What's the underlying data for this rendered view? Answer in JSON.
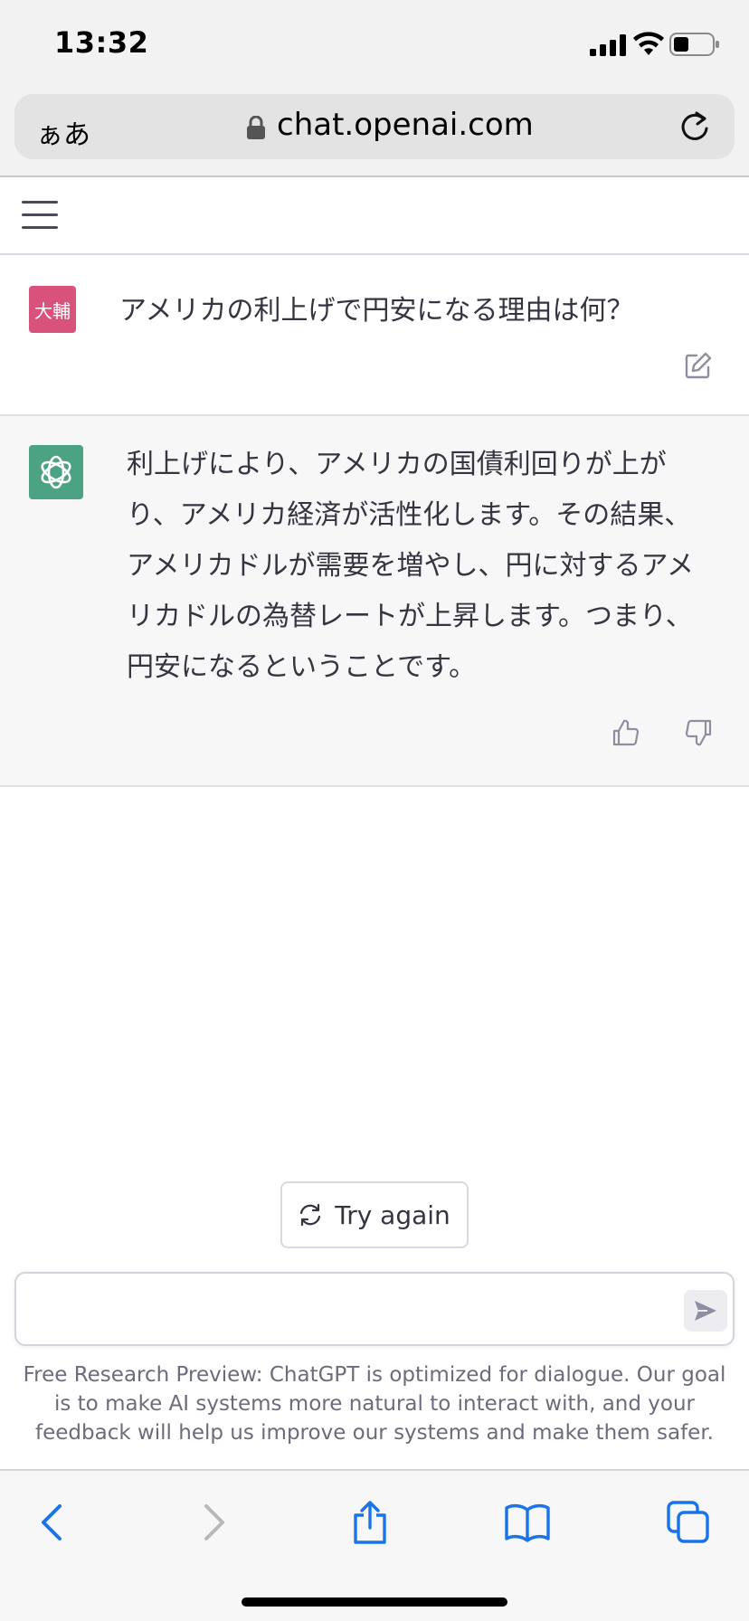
{
  "status": {
    "time": "13:32"
  },
  "browser": {
    "aa_label": "ぁあ",
    "url": "chat.openai.com"
  },
  "conversation": {
    "user": {
      "avatar_text": "大輔",
      "avatar_color": "#d9527c",
      "message": "アメリカの利上げで円安になる理由は何？"
    },
    "assistant": {
      "avatar_color": "#4ba383",
      "lines": [
        "利上げにより、アメリカの国債利回りが上が",
        "り、アメリカ経済が活性化します。その結果、",
        "アメリカドルが需要を増やし、円に対するアメ",
        "リカドルの為替レートが上昇します。つまり、",
        "円安になるということです。"
      ]
    }
  },
  "actions": {
    "try_again": "Try again"
  },
  "input": {
    "placeholder": "",
    "value": ""
  },
  "disclaimer": "Free Research Preview: ChatGPT is optimized for dialogue. Our goal is to make AI systems more natural to interact with, and your feedback will help us improve our systems and make them safer.",
  "toolbar": {
    "icons": [
      "back-icon",
      "forward-icon",
      "share-icon",
      "bookmarks-icon",
      "tabs-icon"
    ],
    "accent": "#1a73e8"
  }
}
